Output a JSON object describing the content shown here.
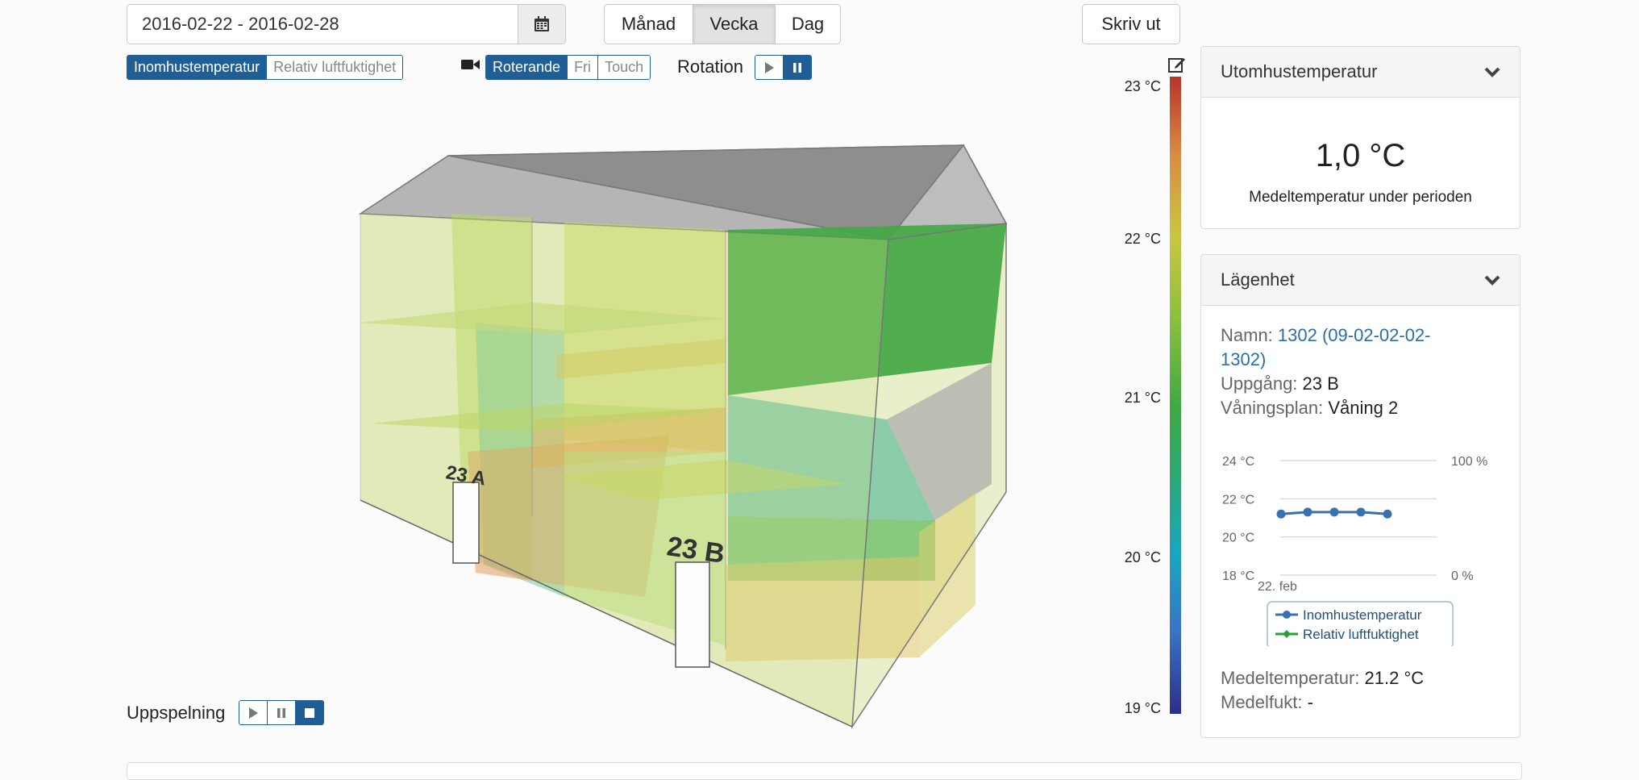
{
  "toolbar": {
    "date_range": "2016-02-22 - 2016-02-28",
    "period_buttons": [
      "Månad",
      "Vecka",
      "Dag"
    ],
    "active_period": "Vecka",
    "print_label": "Skriv ut"
  },
  "view": {
    "measure_toggles": [
      "Inomhustemperatur",
      "Relativ luftfuktighet"
    ],
    "active_measure": "Inomhustemperatur",
    "camera_modes": [
      "Roterande",
      "Fri",
      "Touch"
    ],
    "active_camera": "Roterande",
    "rotation_label": "Rotation",
    "playback_label": "Uppspelning"
  },
  "building": {
    "entrances": [
      "23 A",
      "23 B"
    ]
  },
  "scale": {
    "labels": [
      "23 °C",
      "22 °C",
      "21 °C",
      "20 °C",
      "19 °C"
    ],
    "colors": [
      "#b8342b",
      "#a8b22a",
      "#2f9a3a",
      "#1aa6c0",
      "#2c2f86"
    ]
  },
  "outdoor_panel": {
    "title": "Utomhustemperatur",
    "value": "1,0 °C",
    "caption": "Medeltemperatur under perioden"
  },
  "apartment_panel": {
    "title": "Lägenhet",
    "name_label": "Namn:",
    "name_value_1": "1302 (09-02-02-02-",
    "name_value_2": "1302)",
    "entrance_label": "Uppgång:",
    "entrance_value": "23 B",
    "floor_label": "Våningsplan:",
    "floor_value": "Våning 2",
    "avg_temp_label": "Medeltemperatur:",
    "avg_temp_value": "21.2 °C",
    "avg_humidity_label": "Medelfukt:",
    "avg_humidity_value": "-"
  },
  "chart_data": {
    "type": "line",
    "y_ticks_left": [
      "24 °C",
      "22 °C",
      "20 °C",
      "18 °C"
    ],
    "y_ticks_right": [
      "100 %",
      "0 %"
    ],
    "x_tick": "22. feb",
    "ylim": [
      18,
      24
    ],
    "series": [
      {
        "name": "Inomhustemperatur",
        "color": "#3a6fb0",
        "values": [
          21.2,
          21.3,
          21.3,
          21.3,
          21.2
        ]
      },
      {
        "name": "Relativ luftfuktighet",
        "color": "#2aa03a",
        "values": []
      }
    ]
  }
}
